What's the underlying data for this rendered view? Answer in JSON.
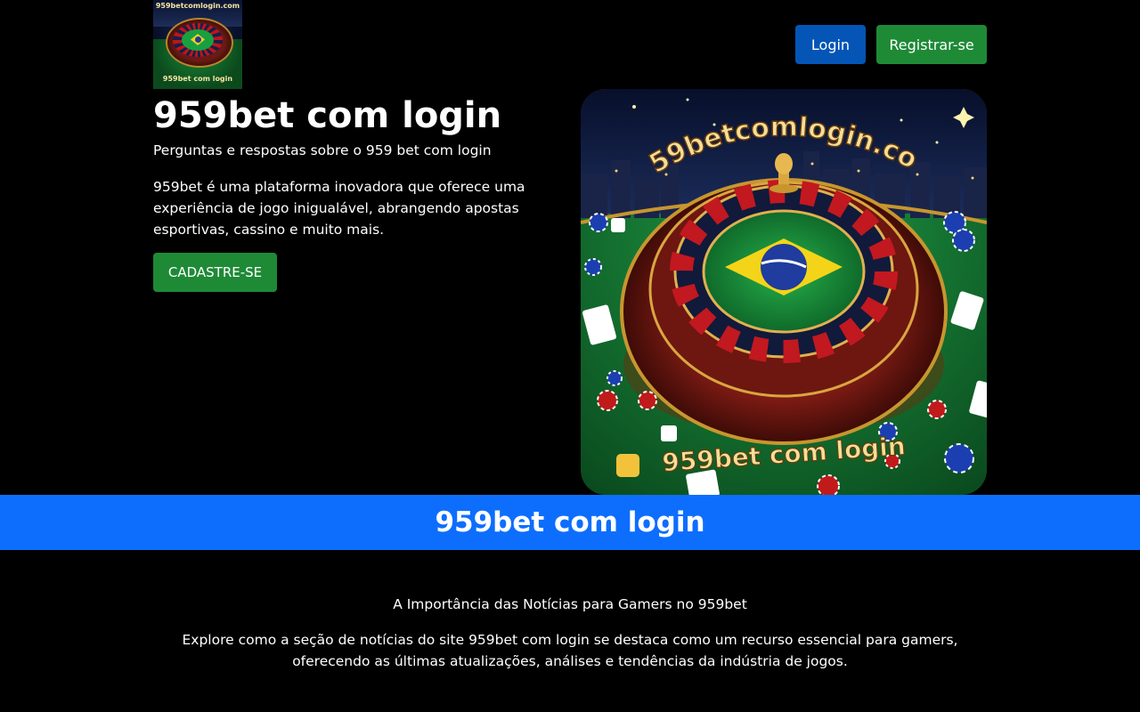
{
  "header": {
    "logo_top_text": "959betcomlogin.com",
    "logo_bottom_text": "959bet com login",
    "login_label": "Login",
    "register_label": "Registrar-se"
  },
  "hero": {
    "title": "959bet com login",
    "subtitle": "Perguntas e respostas sobre o 959 bet com login",
    "description": "959bet é uma plataforma inovadora que oferece uma experiência de jogo inigualável, abrangendo apostas esportivas, cassino e muito mais.",
    "cta_label": "CADASTRE-SE",
    "image": {
      "top_text": "959betcomlogin.com",
      "bottom_text": "959bet com login"
    }
  },
  "banner": {
    "title": "959bet com login"
  },
  "section": {
    "title": "A Importância das Notícias para Gamers no 959bet",
    "text": "Explore como a seção de notícias do site 959bet com login se destaca como um recurso essencial para gamers, oferecendo as últimas atualizações, análises e tendências da indústria de jogos."
  },
  "colors": {
    "background": "#000000",
    "login_button": "#0455b6",
    "register_button": "#1e8a36",
    "cta_button": "#1e8a36",
    "banner": "#0d6efd"
  }
}
